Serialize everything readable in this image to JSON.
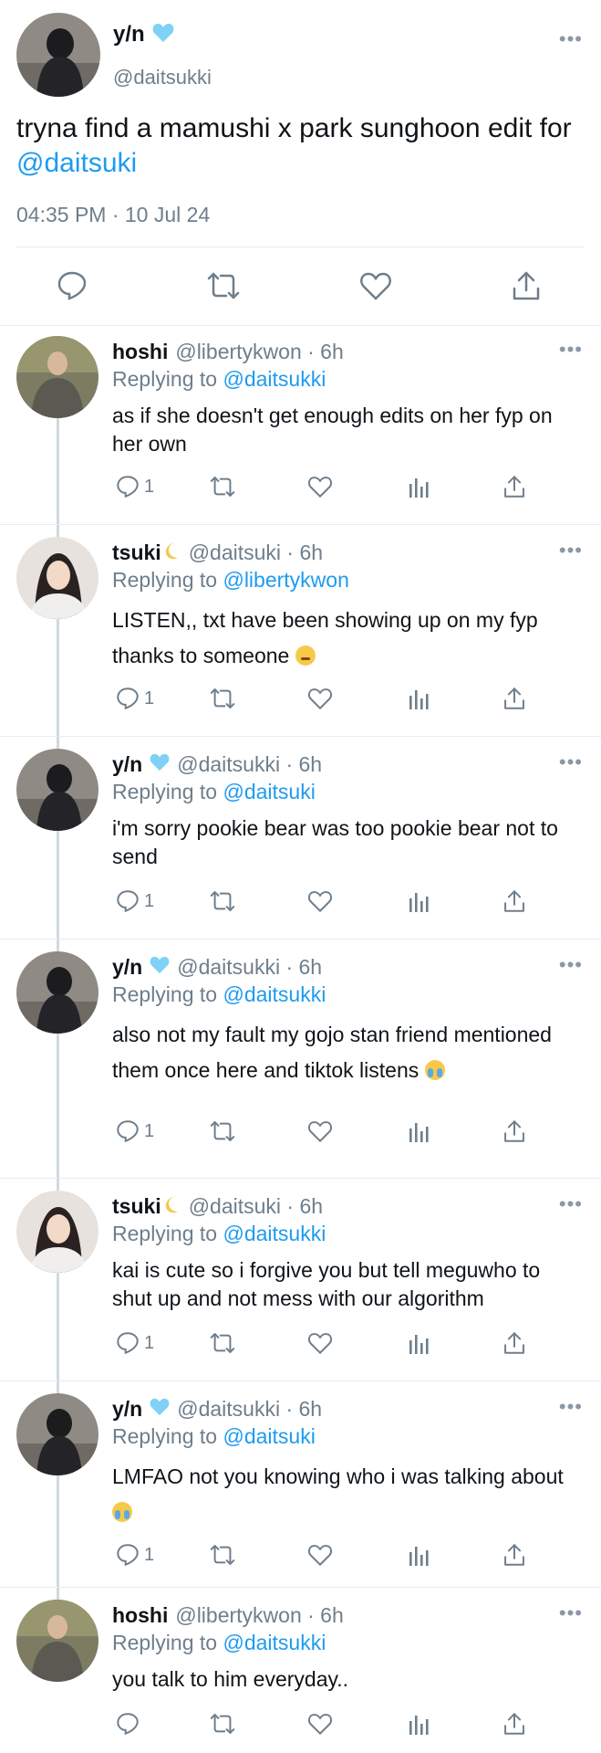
{
  "main_tweet": {
    "name": "y/n",
    "verified_color": "#7fd1f5",
    "handle": "@daitsukki",
    "text": "tryna find a mamushi x park sunghoon edit for ",
    "mention": "@daitsuki",
    "timestamp": "04:35 PM · 10 Jul 24",
    "more_icon": "more-dots-icon",
    "actions": [
      "reply-icon",
      "retweet-icon",
      "like-icon",
      "share-icon"
    ]
  },
  "replies": [
    {
      "name": "hoshi",
      "verified": false,
      "moon": false,
      "meta": "@libertykwon · 6h",
      "replying_label": "Replying to ",
      "replying_to": "@daitsukki",
      "text": "as if she doesn't get enough edits on her fyp on her own",
      "emoji": "",
      "reply_count": "1"
    },
    {
      "name": "tsuki",
      "verified": false,
      "moon": true,
      "meta": "@daitsuki · 6h",
      "replying_label": "Replying to ",
      "replying_to": "@libertykwon",
      "text": "LISTEN,, txt have been showing up on my fyp thanks to someone ",
      "emoji": "huffing-face",
      "reply_count": "1"
    },
    {
      "name": "y/n",
      "verified": true,
      "moon": false,
      "meta": "@daitsukki · 6h",
      "replying_label": "Replying to ",
      "replying_to": "@daitsuki",
      "text": "i'm sorry pookie bear was too pookie bear not to send",
      "emoji": "",
      "reply_count": "1"
    },
    {
      "name": "y/n",
      "verified": true,
      "moon": false,
      "meta": "@daitsukki · 6h",
      "replying_label": "Replying to ",
      "replying_to": "@daitsukki",
      "text": "also not my fault my gojo stan friend mentioned them once here and tiktok listens ",
      "emoji": "crying-face",
      "reply_count": "1"
    },
    {
      "name": "tsuki",
      "verified": false,
      "moon": true,
      "meta": "@daitsuki · 6h",
      "replying_label": "Replying to ",
      "replying_to": "@daitsukki",
      "text": "kai is cute so i forgive you but tell meguwho to shut up and not mess with our algorithm",
      "emoji": "",
      "reply_count": "1"
    },
    {
      "name": "y/n",
      "verified": true,
      "moon": false,
      "meta": "@daitsukki · 6h",
      "replying_label": "Replying to ",
      "replying_to": "@daitsuki",
      "text": "LMFAO not you knowing who i was talking about ",
      "emoji": "crying-face",
      "reply_count": "1"
    },
    {
      "name": "hoshi",
      "verified": false,
      "moon": false,
      "meta": "@libertykwon · 6h",
      "replying_label": "Replying to ",
      "replying_to": "@daitsukki",
      "text": "you talk to him everyday..",
      "emoji": "",
      "reply_count": ""
    }
  ],
  "colors": {
    "link": "#1d9bf0",
    "muted": "#6e7e8c",
    "divider": "#e6ecf0"
  }
}
